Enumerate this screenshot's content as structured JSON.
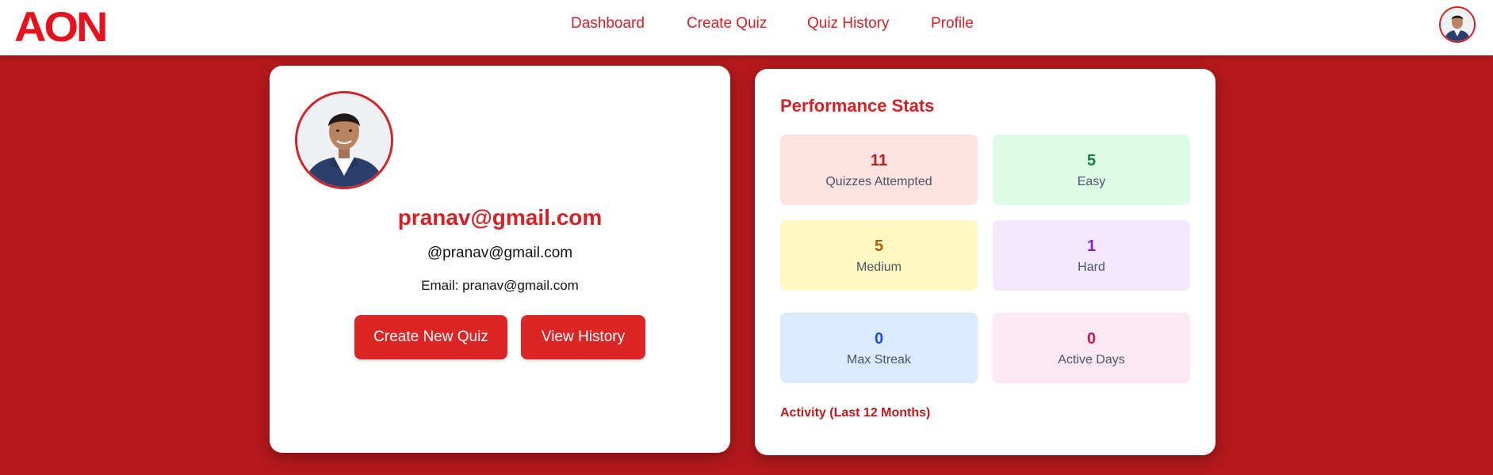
{
  "header": {
    "logo_text": "AON",
    "nav": {
      "dashboard": "Dashboard",
      "create_quiz": "Create Quiz",
      "quiz_history": "Quiz History",
      "profile": "Profile"
    }
  },
  "profile": {
    "name": "pranav@gmail.com",
    "handle": "@pranav@gmail.com",
    "email_line": "Email: pranav@gmail.com",
    "buttons": {
      "create_new_quiz": "Create New Quiz",
      "view_history": "View History"
    }
  },
  "stats": {
    "title": "Performance Stats",
    "items": [
      {
        "value": "11",
        "label": "Quizzes Attempted",
        "color": "#b91c1c",
        "bg": "#fee2e2"
      },
      {
        "value": "5",
        "label": "Easy",
        "color": "#15803d",
        "bg": "#dcfce7"
      },
      {
        "value": "5",
        "label": "Medium",
        "color": "#a16207",
        "bg": "#fef9c3"
      },
      {
        "value": "1",
        "label": "Hard",
        "color": "#7e22ce",
        "bg": "#f3e8ff"
      },
      {
        "value": "0",
        "label": "Max Streak",
        "color": "#1d4ed8",
        "bg": "#dbeafe"
      },
      {
        "value": "0",
        "label": "Active Days",
        "color": "#be185d",
        "bg": "#fce7f3"
      }
    ],
    "activity_title": "Activity (Last 12 Months)"
  },
  "colors": {
    "brand_red": "#d42127",
    "page_background": "#b5191c",
    "button_red": "#dc2626"
  }
}
